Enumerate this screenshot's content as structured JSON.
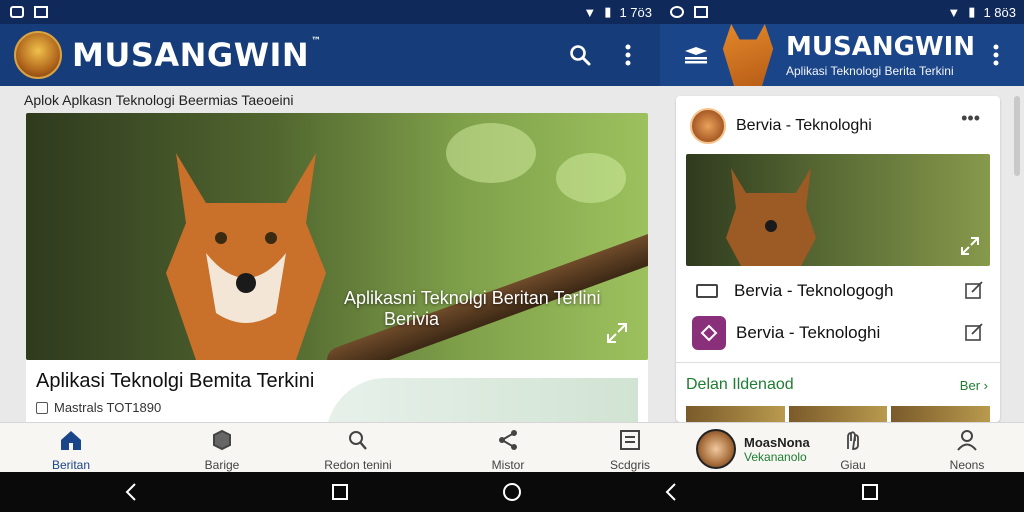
{
  "status_bar": {
    "left_time": "1 7ö3",
    "right_time": "1 8ö3"
  },
  "app_bar": {
    "brand": "MUSANGWIN",
    "trademark": "™"
  },
  "right_panel": {
    "brand": "MUSANGWIN",
    "subtitle": "Aplikasi Teknologi Berita Terkini"
  },
  "breadcrumbs": "Aplok Aplkasn Teknologi Beermias Taeoeini",
  "hero": {
    "caption_line1": "Aplikasni Teknolgi Beritan Terlini",
    "caption_line2": "Berivia"
  },
  "article": {
    "title": "Aplikasi Teknolgi Bemita Terkini",
    "meta": "Mastrals TOT1890"
  },
  "side_card": {
    "header_title": "Bervia - Teknologhi",
    "list": [
      {
        "label": "Bervia - Teknologogh"
      },
      {
        "label": "Bervia - Teknologhi"
      }
    ],
    "section_title": "Delan Ildenaod",
    "section_more": "Ber"
  },
  "bottom_nav": {
    "items": [
      {
        "label": "Beritan",
        "icon": "home-icon"
      },
      {
        "label": "Barige",
        "icon": "tag-icon"
      },
      {
        "label": "Redon tenini",
        "icon": "search-icon"
      },
      {
        "label": "Mistor",
        "icon": "share-icon"
      },
      {
        "label": "Scdgris",
        "icon": "document-icon"
      },
      {
        "label": "Giau",
        "icon": "hand-icon"
      },
      {
        "label": "Neons",
        "icon": "person-icon"
      }
    ],
    "profile": {
      "name": "MoasNona",
      "subtitle": "Vekananolo"
    }
  },
  "colors": {
    "appbar": "#163d7a",
    "status": "#0f2a5a",
    "accent_green": "#1e7d32",
    "purple": "#8a2f7a"
  }
}
